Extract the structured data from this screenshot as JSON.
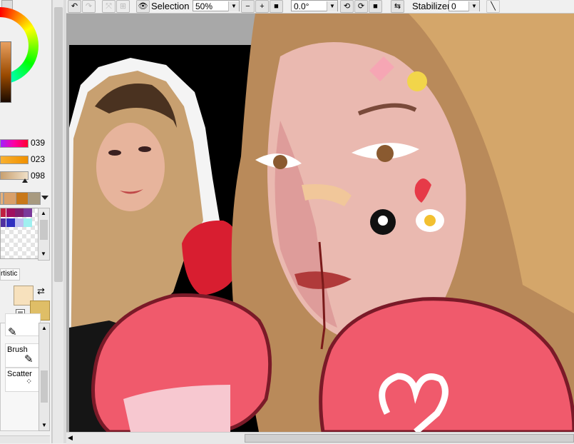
{
  "toolbar": {
    "selection_label": "Selection",
    "zoom_value": "50%",
    "rotation_value": "0.0°",
    "stabilizer_label": "Stabilizer",
    "stabilizer_value": "0"
  },
  "color_panel": {
    "slider_values": [
      "039",
      "023",
      "098"
    ],
    "swatches": [
      "#e6b07a",
      "#d9a06a",
      "#c8781a",
      "#a89a80"
    ],
    "palette": [
      "#c02040",
      "#a01060",
      "#802070",
      "#7a3a9a",
      "#5030a0",
      "#3030c0",
      "#c0c0f0",
      "#a0f0f0"
    ],
    "fg_color": "#f7e1bd",
    "bg_color": "#dfbe67"
  },
  "brush_panel": {
    "mode_label": "rtistic",
    "tools": [
      "Brush",
      "Scatter"
    ]
  },
  "icons": {
    "undo": "undo-icon",
    "redo": "redo-icon",
    "eye": "eye-icon",
    "zoom_out": "zoom-out-icon",
    "zoom_in": "zoom-in-icon",
    "rotate_ccw": "rotate-ccw-icon",
    "rotate_cw": "rotate-cw-icon",
    "flip": "flip-icon",
    "line": "line-icon"
  }
}
